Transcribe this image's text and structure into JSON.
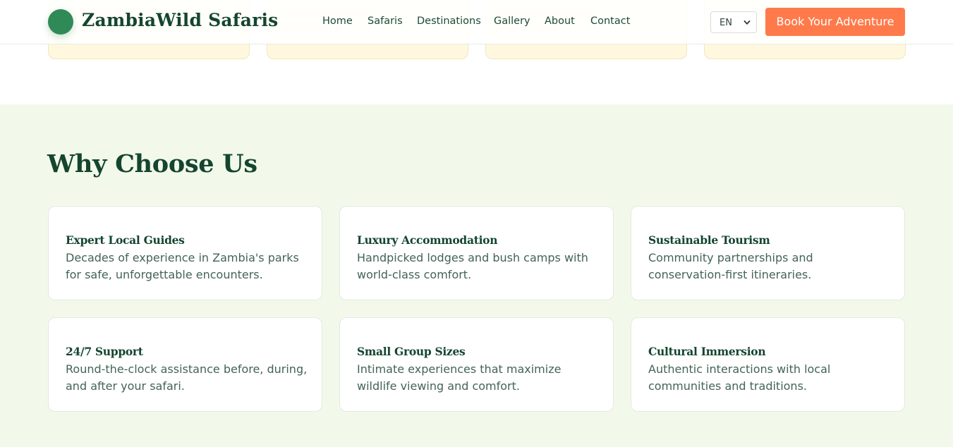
{
  "header": {
    "brand": "ZambiaWild Safaris",
    "nav": [
      "Home",
      "Safaris",
      "Destinations",
      "Gallery",
      "About",
      "Contact"
    ],
    "language": "EN",
    "cta": "Book Your Adventure"
  },
  "why_choose_us": {
    "title": "Why Choose Us",
    "features": [
      {
        "title": "Expert Local Guides",
        "description": "Decades of experience in Zambia's parks for safe, unforgettable encounters."
      },
      {
        "title": "Luxury Accommodation",
        "description": "Handpicked lodges and bush camps with world-class comfort."
      },
      {
        "title": "Sustainable Tourism",
        "description": "Community partnerships and conservation-first itineraries."
      },
      {
        "title": "24/7 Support",
        "description": "Round-the-clock assistance before, during, and after your safari."
      },
      {
        "title": "Small Group Sizes",
        "description": "Intimate experiences that maximize wildlife viewing and comfort."
      },
      {
        "title": "Cultural Immersion",
        "description": "Authentic interactions with local communities and traditions."
      }
    ]
  },
  "colors": {
    "brand_green": "#2f8a57",
    "heading_green": "#14452f",
    "cta_orange": "#ff7a4a",
    "section_bg": "#f3f9ea",
    "prev_card_bg": "#fff8de"
  },
  "icons": {
    "language_dropdown": "chevron-down-icon",
    "logo": "logo-circle-icon"
  }
}
